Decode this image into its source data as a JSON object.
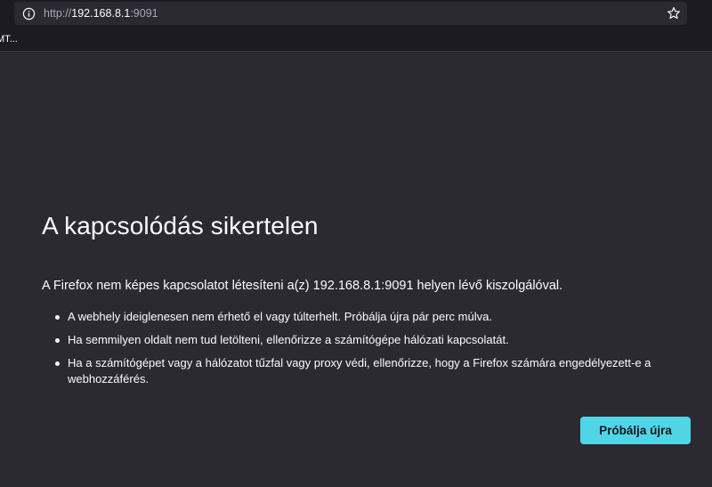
{
  "browser": {
    "url": {
      "scheme": "http://",
      "host": "192.168.8.1",
      "port": ":9091"
    },
    "bookmark_label": "MT..."
  },
  "error_page": {
    "title": "A kapcsolódás sikertelen",
    "intro": "A Firefox nem képes kapcsolatot létesíteni a(z) 192.168.8.1:9091 helyen lévő kiszolgálóval.",
    "suggestions": [
      "A webhely ideiglenesen nem érhető el vagy túlterhelt. Próbálja újra pár perc múlva.",
      "Ha semmilyen oldalt nem tud letölteni, ellenőrizze a számítógépe hálózati kapcsolatát.",
      "Ha a számítógépet vagy a hálózatot tűzfal vagy proxy védi, ellenőrizze, hogy a Firefox számára engedélyezett-e a webhozzáférés."
    ],
    "retry_label": "Próbálja újra"
  },
  "colors": {
    "page_background": "#2b2a33",
    "toolbar_background": "#1c1b22",
    "accent": "#4fd5e6",
    "text": "#fbfbfe"
  },
  "icons": {
    "site_info": "info-icon",
    "bookmark": "star-icon"
  }
}
